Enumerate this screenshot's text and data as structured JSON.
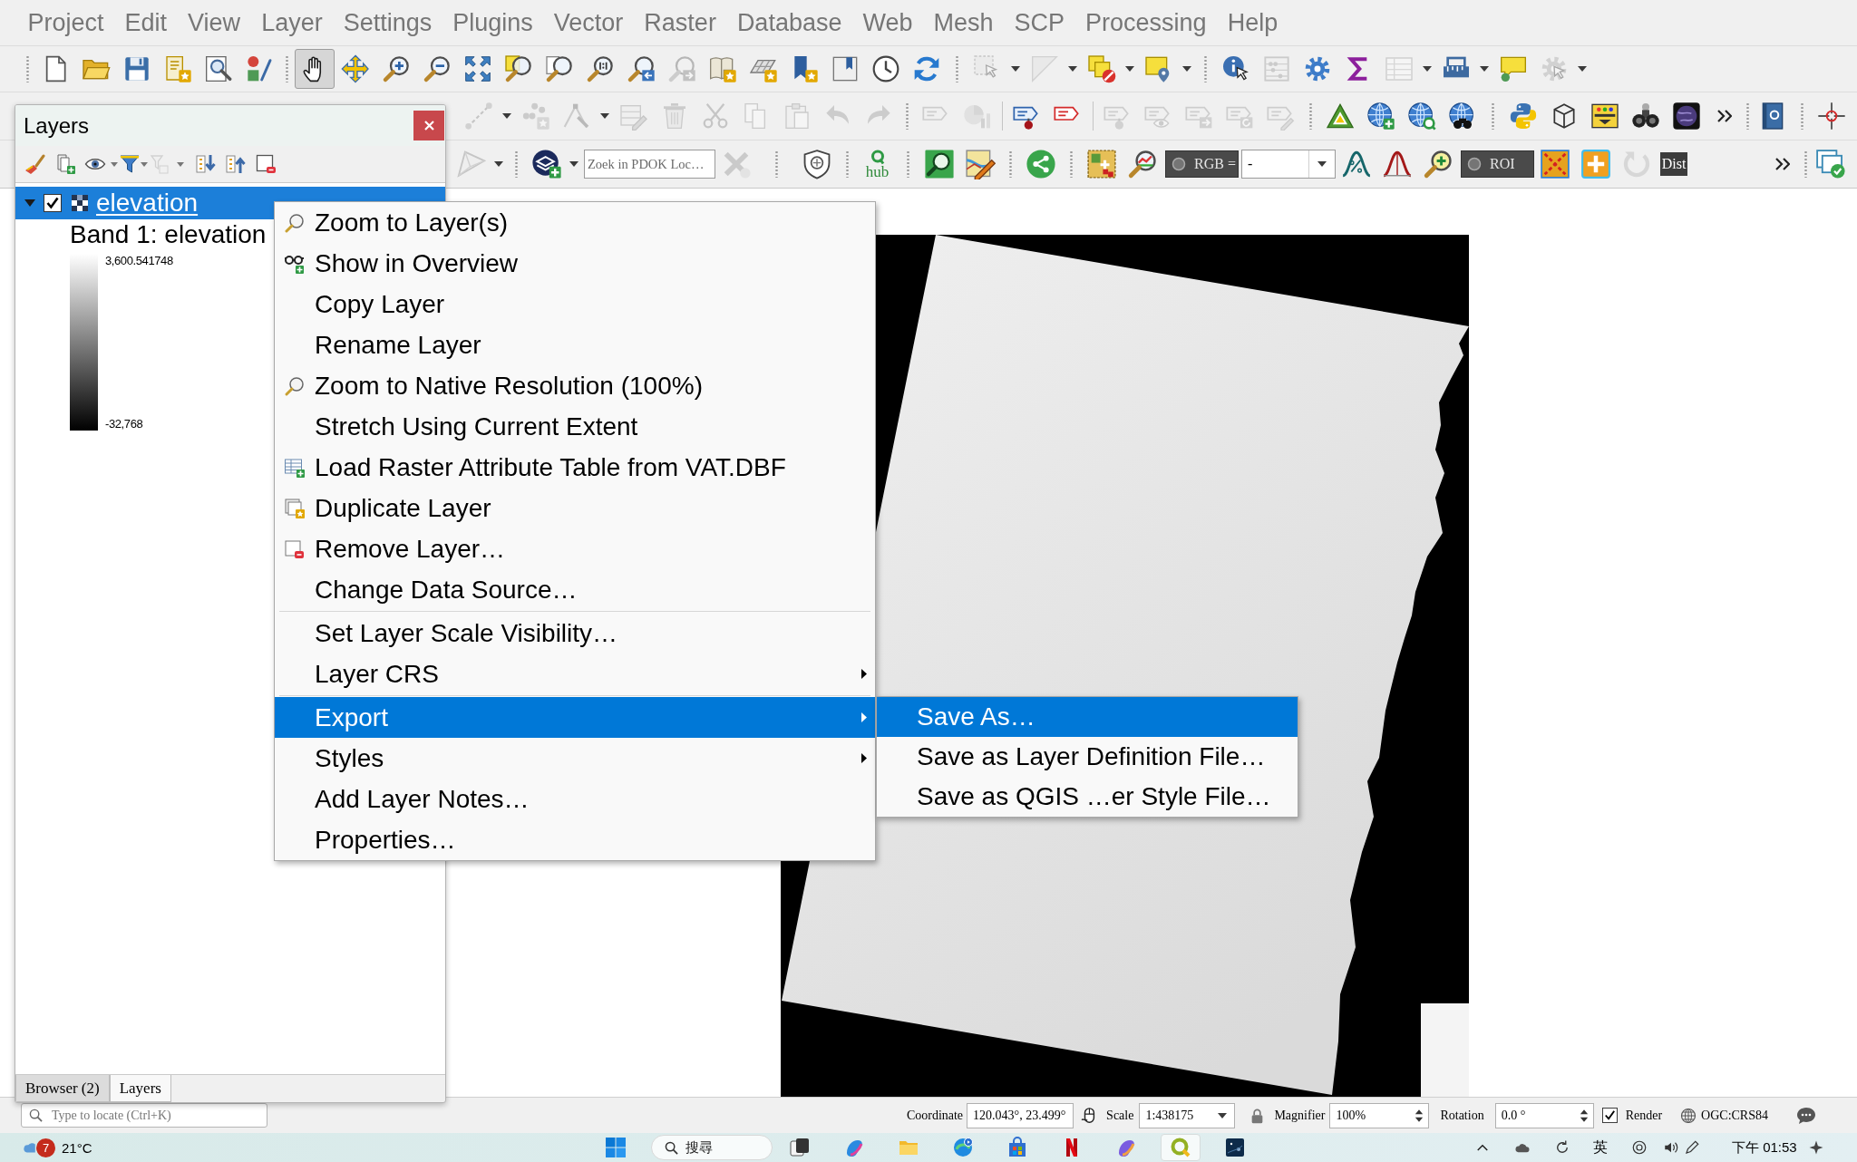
{
  "menu_bar": [
    "Project",
    "Edit",
    "View",
    "Layer",
    "Settings",
    "Plugins",
    "Vector",
    "Raster",
    "Database",
    "Web",
    "Mesh",
    "SCP",
    "Processing",
    "Help"
  ],
  "toolbars": [
    {
      "items": [
        {
          "disabled": false,
          "selected": false
        },
        {
          "disabled": false,
          "selected": false
        },
        {
          "disabled": false,
          "selected": false
        },
        {
          "disabled": false,
          "selected": false
        },
        {
          "disabled": false,
          "selected": false
        },
        {
          "disabled": false,
          "selected": false
        },
        {
          "disabled": false,
          "selected": true
        },
        {
          "disabled": false,
          "selected": false
        },
        {
          "disabled": false,
          "selected": false
        },
        {
          "disabled": false,
          "selected": false
        },
        {
          "disabled": false,
          "selected": false
        },
        {
          "disabled": false,
          "selected": false
        },
        {
          "disabled": false,
          "selected": false
        },
        {
          "disabled": false,
          "selected": false
        },
        {
          "disabled": false,
          "selected": false
        },
        {
          "disabled": true,
          "selected": false
        },
        {
          "disabled": false,
          "selected": false
        },
        {
          "disabled": false,
          "selected": false
        },
        {
          "disabled": false,
          "selected": false
        },
        {
          "disabled": false,
          "selected": false
        },
        {
          "disabled": false,
          "selected": false
        },
        {
          "disabled": false,
          "selected": false
        },
        {
          "disabled": true,
          "selected": false
        },
        {
          "disabled": true,
          "selected": false
        },
        {
          "disabled": false,
          "selected": false
        },
        {
          "disabled": false,
          "selected": false
        },
        {
          "disabled": false,
          "selected": false
        },
        {
          "disabled": true,
          "selected": false
        },
        {
          "disabled": false,
          "selected": false
        },
        {
          "disabled": false,
          "selected": false
        },
        {
          "disabled": true,
          "selected": false
        },
        {
          "disabled": false,
          "selected": false
        },
        {
          "disabled": false,
          "selected": false
        },
        {
          "disabled": true,
          "selected": false
        }
      ]
    },
    {
      "items": [
        {
          "disabled": true
        },
        {
          "disabled": true
        },
        {
          "disabled": true
        },
        {
          "disabled": true
        },
        {
          "disabled": true
        },
        {
          "disabled": true
        },
        {
          "disabled": true
        },
        {
          "disabled": true
        },
        {
          "disabled": true
        },
        {
          "disabled": true
        },
        {
          "disabled": true
        },
        {
          "disabled": true
        },
        {
          "disabled": false
        },
        {
          "disabled": false
        },
        {
          "disabled": true
        },
        {
          "disabled": true
        },
        {
          "disabled": true
        },
        {
          "disabled": true
        },
        {
          "disabled": true
        },
        {
          "disabled": false
        },
        {
          "disabled": false
        },
        {
          "disabled": false
        },
        {
          "disabled": false
        },
        {
          "disabled": false
        },
        {
          "disabled": false
        },
        {
          "disabled": false
        },
        {
          "disabled": false
        },
        {
          "disabled": false
        },
        {
          "disabled": false
        },
        {
          "disabled": false
        },
        {
          "disabled": false
        }
      ]
    },
    {
      "items": [
        {
          "kind": "button",
          "disabled": true
        },
        {
          "kind": "button",
          "disabled": false
        },
        {
          "kind": "search",
          "placeholder": "Zoek in PDOK Loc…"
        },
        {
          "kind": "button",
          "disabled": true
        },
        {
          "kind": "button",
          "disabled": false
        },
        {
          "kind": "logo",
          "label": "hub",
          "disabled": false
        },
        {
          "kind": "button",
          "disabled": false
        },
        {
          "kind": "button",
          "disabled": false
        },
        {
          "kind": "button",
          "disabled": false
        },
        {
          "kind": "button",
          "disabled": false
        },
        {
          "kind": "button",
          "disabled": false
        },
        {
          "kind": "toggle",
          "label": "RGB =",
          "checked": false
        },
        {
          "kind": "combo",
          "value": "-"
        },
        {
          "kind": "button",
          "disabled": false
        },
        {
          "kind": "button",
          "disabled": false
        },
        {
          "kind": "button",
          "disabled": false
        },
        {
          "kind": "toggle",
          "label": "ROI",
          "checked": false
        },
        {
          "kind": "button",
          "disabled": false
        },
        {
          "kind": "button",
          "disabled": false
        },
        {
          "kind": "button",
          "disabled": true
        },
        {
          "kind": "tag",
          "label": "Dist"
        },
        {
          "kind": "button",
          "disabled": false
        },
        {
          "kind": "button",
          "disabled": false
        }
      ]
    }
  ],
  "layers_panel": {
    "title": "Layers",
    "toolbar": [
      {
        "disabled": false
      },
      {
        "disabled": false
      },
      {
        "disabled": false
      },
      {
        "disabled": false
      },
      {
        "disabled": true
      },
      {
        "disabled": false
      },
      {
        "disabled": false
      },
      {
        "disabled": false
      }
    ],
    "tree": [
      {
        "label": "elevation",
        "selected": true,
        "checked": true,
        "expanded": true,
        "children": [
          {
            "kind": "label",
            "label": "Band 1: elevation"
          },
          {
            "kind": "ramp",
            "max": "3,600.541748",
            "min": "-32,768"
          }
        ]
      }
    ],
    "tabs": [
      {
        "label": "Browser (2)",
        "selected": false
      },
      {
        "label": "Layers",
        "selected": true
      }
    ]
  },
  "context_menu": {
    "items": [
      {
        "kind": "item",
        "label": "Zoom to Layer(s)",
        "selected": false,
        "submenu": false
      },
      {
        "kind": "item",
        "label": "Show in Overview",
        "selected": false,
        "submenu": false
      },
      {
        "kind": "item",
        "label": "Copy Layer",
        "selected": false,
        "submenu": false
      },
      {
        "kind": "item",
        "label": "Rename Layer",
        "selected": false,
        "submenu": false
      },
      {
        "kind": "item",
        "label": "Zoom to Native Resolution (100%)",
        "selected": false,
        "submenu": false
      },
      {
        "kind": "item",
        "label": "Stretch Using Current Extent",
        "selected": false,
        "submenu": false
      },
      {
        "kind": "item",
        "label": "Load Raster Attribute Table from VAT.DBF",
        "selected": false,
        "submenu": false
      },
      {
        "kind": "item",
        "label": "Duplicate Layer",
        "selected": false,
        "submenu": false
      },
      {
        "kind": "item",
        "label": "Remove Layer…",
        "selected": false,
        "submenu": false
      },
      {
        "kind": "item",
        "label": "Change Data Source…",
        "selected": false,
        "submenu": false
      },
      {
        "kind": "separator"
      },
      {
        "kind": "item",
        "label": "Set Layer Scale Visibility…",
        "selected": false,
        "submenu": false
      },
      {
        "kind": "item",
        "label": "Layer CRS",
        "selected": false,
        "submenu": true
      },
      {
        "kind": "separator"
      },
      {
        "kind": "item",
        "label": "Export",
        "selected": true,
        "submenu": true
      },
      {
        "kind": "item",
        "label": "Styles",
        "selected": false,
        "submenu": true
      },
      {
        "kind": "item",
        "label": "Add Layer Notes…",
        "selected": false,
        "submenu": false
      },
      {
        "kind": "item",
        "label": "Properties…",
        "selected": false,
        "submenu": false
      }
    ]
  },
  "submenu": {
    "items": [
      {
        "label": "Save As…",
        "selected": true
      },
      {
        "label": "Save as Layer Definition File…",
        "selected": false
      },
      {
        "label": "Save as QGIS …er Style File…",
        "selected": false
      }
    ]
  },
  "status_bar": {
    "locator": {
      "placeholder": "Type to locate (Ctrl+K)"
    },
    "coordinate": {
      "label": "Coordinate",
      "value": "120.043°, 23.499°"
    },
    "scale": {
      "label": "Scale",
      "value": "1:438175"
    },
    "magnifier": {
      "label": "Magnifier",
      "value": "100%"
    },
    "rotation": {
      "label": "Rotation",
      "value": "0.0 °"
    },
    "render": {
      "label": "Render",
      "checked": true
    },
    "crs": "OGC:CRS84"
  },
  "taskbar": {
    "weather": {
      "badge": "7",
      "temperature": "21°C"
    },
    "search": {
      "label": "搜尋"
    },
    "apps": [
      {
        "selected": false
      },
      {
        "selected": false
      },
      {
        "selected": false
      },
      {
        "selected": false
      },
      {
        "selected": false
      },
      {
        "selected": false
      },
      {
        "selected": false
      },
      {
        "selected": true
      },
      {
        "selected": false
      }
    ],
    "input_method": "英",
    "clock": "下午 01:53"
  }
}
